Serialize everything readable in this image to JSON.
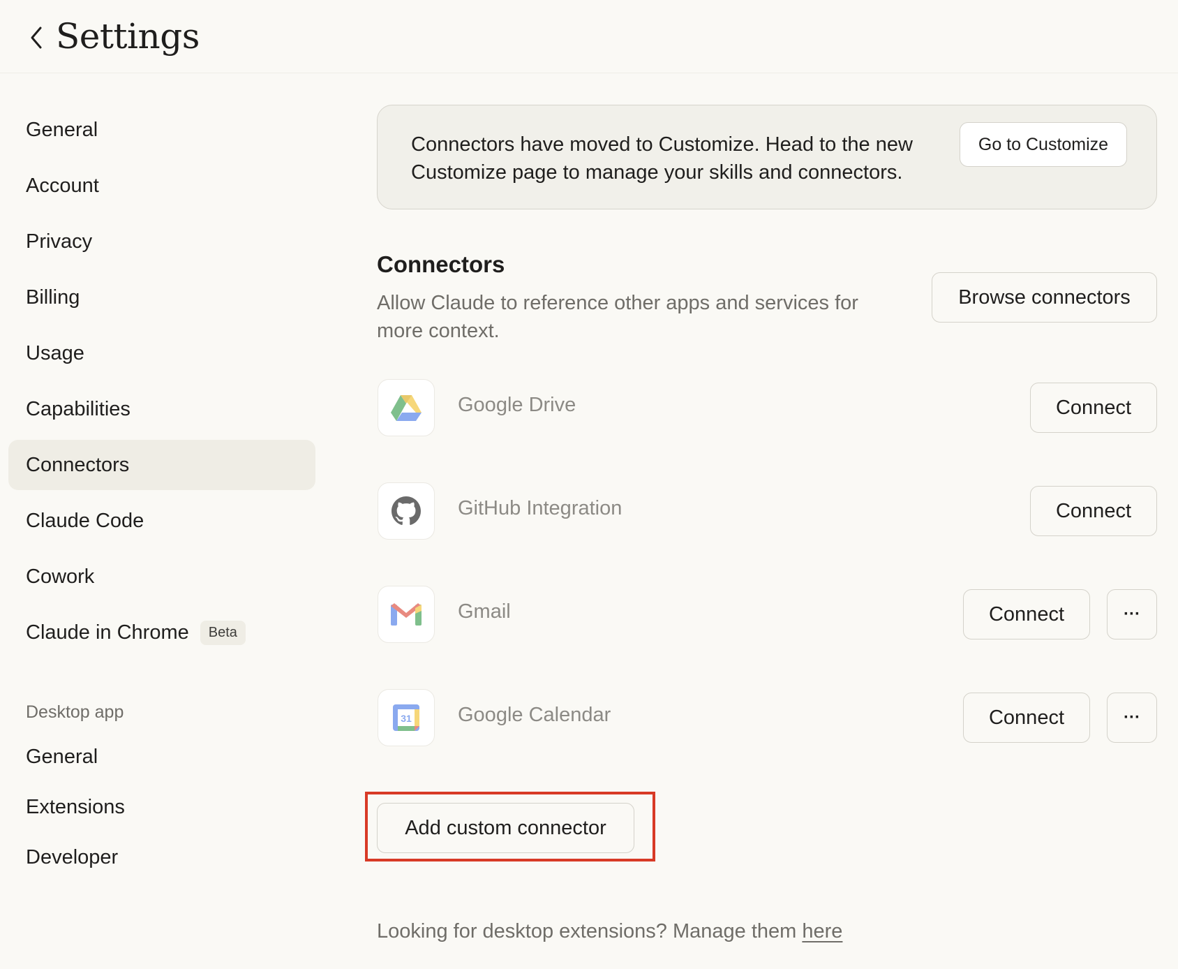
{
  "header": {
    "title": "Settings"
  },
  "sidebar": {
    "items": [
      {
        "label": "General"
      },
      {
        "label": "Account"
      },
      {
        "label": "Privacy"
      },
      {
        "label": "Billing"
      },
      {
        "label": "Usage"
      },
      {
        "label": "Capabilities"
      },
      {
        "label": "Connectors",
        "active": true
      },
      {
        "label": "Claude Code"
      },
      {
        "label": "Cowork"
      },
      {
        "label": "Claude in Chrome",
        "badge": "Beta"
      }
    ],
    "desktop_section_label": "Desktop app",
    "desktop_items": [
      {
        "label": "General"
      },
      {
        "label": "Extensions"
      },
      {
        "label": "Developer"
      }
    ]
  },
  "notice": {
    "text": "Connectors have moved to Customize. Head to the new Customize page to manage your skills and connectors.",
    "button_label": "Go to Customize"
  },
  "connectors": {
    "title": "Connectors",
    "description": "Allow Claude to reference other apps and services for more context.",
    "browse_label": "Browse connectors",
    "items": [
      {
        "name": "Google Drive",
        "icon": "google-drive-icon",
        "action": "Connect",
        "has_more": false
      },
      {
        "name": "GitHub Integration",
        "icon": "github-icon",
        "action": "Connect",
        "has_more": false
      },
      {
        "name": "Gmail",
        "icon": "gmail-icon",
        "action": "Connect",
        "has_more": true,
        "more_label": "···"
      },
      {
        "name": "Google Calendar",
        "icon": "google-calendar-icon",
        "action": "Connect",
        "has_more": true,
        "more_label": "···",
        "icon_text": "31"
      }
    ],
    "add_custom_label": "Add custom connector"
  },
  "footer": {
    "text": "Looking for desktop extensions? Manage them ",
    "link_label": "here"
  },
  "colors": {
    "background": "#faf9f5",
    "active_nav": "#efede5",
    "highlight": "#d83a26"
  }
}
